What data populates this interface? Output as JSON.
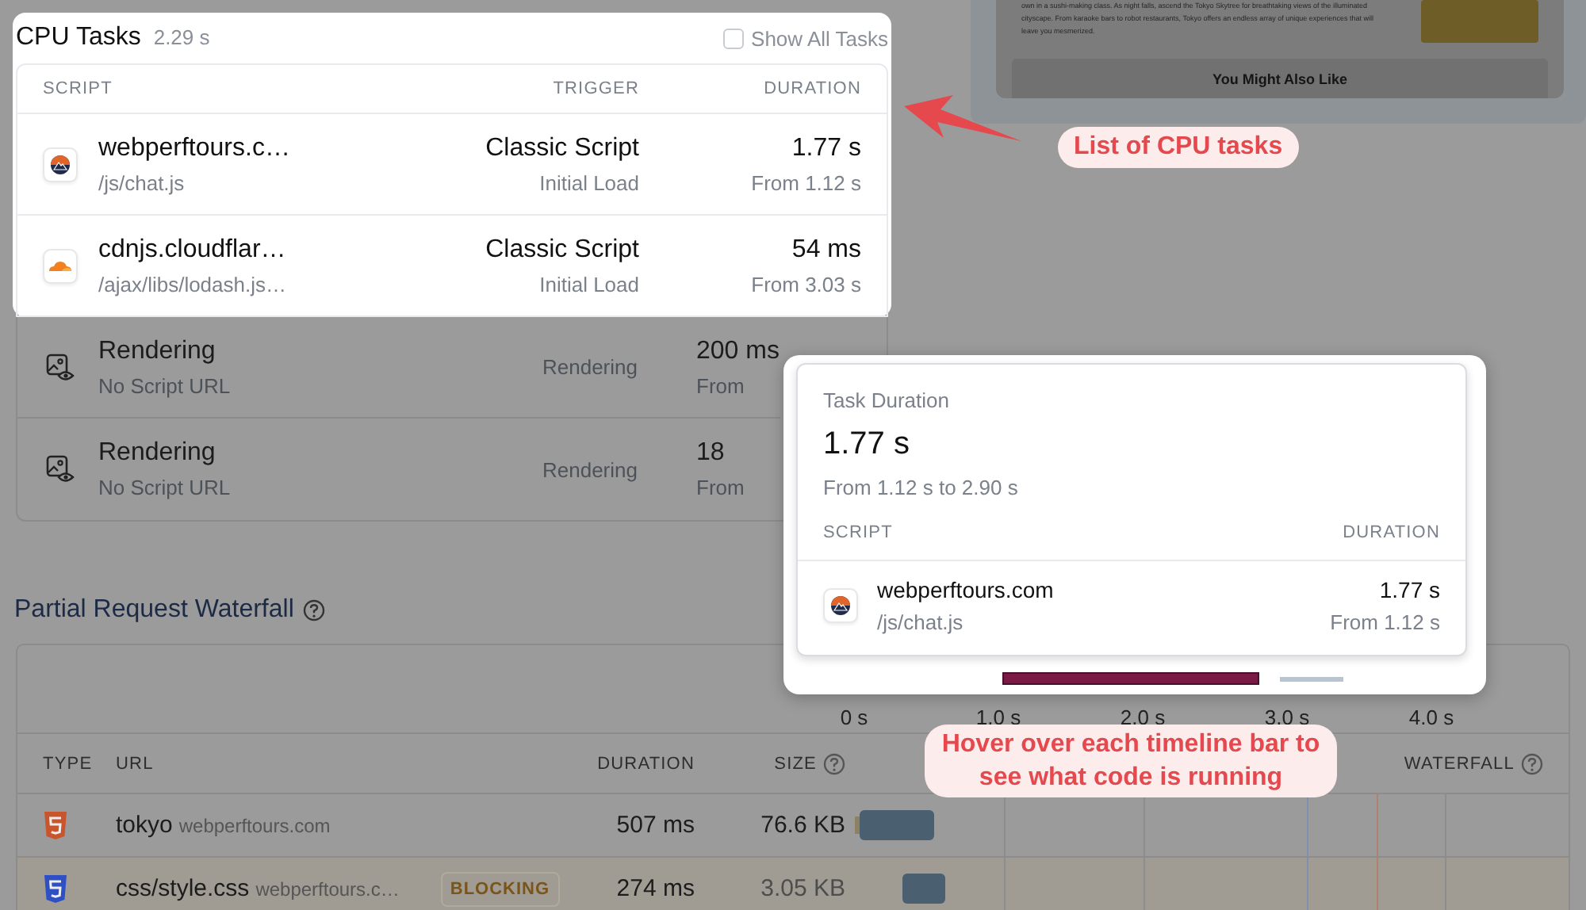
{
  "cpu_tasks": {
    "title": "CPU Tasks",
    "total": "2.29 s",
    "show_all": {
      "label": "Show All Tasks",
      "checked": false
    },
    "columns": [
      "SCRIPT",
      "TRIGGER",
      "DURATION"
    ],
    "rows": [
      {
        "kind": "site",
        "name": "webperftours.c…",
        "path": "/js/chat.js",
        "trigger": "Classic Script",
        "cause": "Initial Load",
        "duration": "1.77 s",
        "start": "From 1.12 s",
        "highlighted": true
      },
      {
        "kind": "cloud",
        "name": "cdnjs.cloudflar…",
        "path": "/ajax/libs/lodash.js…",
        "trigger": "Classic Script",
        "cause": "Initial Load",
        "duration": "54 ms",
        "start": "From 3.03 s",
        "highlighted": true
      },
      {
        "kind": "render",
        "name": "Rendering",
        "path": "No Script URL",
        "cause": "Rendering",
        "duration": "200 ms",
        "start": "From",
        "highlighted": false
      },
      {
        "kind": "render",
        "name": "Rendering",
        "path": "No Script URL",
        "cause": "Rendering",
        "duration": "18",
        "start": "From",
        "highlighted": false
      }
    ]
  },
  "preview": {
    "paragraph": "own in a sushi-making class. As night falls, ascend the Tokyo Skytree for breathtaking views of the illuminated cityscape. From karaoke bars to robot restaurants, Tokyo offers an endless array of unique experiences that will leave you mesmerized.",
    "heading": "You Might Also Like"
  },
  "tooltip": {
    "label": "Task Duration",
    "value": "1.77 s",
    "range": "From 1.12 s to 2.90 s",
    "columns": [
      "SCRIPT",
      "DURATION"
    ],
    "row": {
      "kind": "site",
      "name": "webperftours.com",
      "path": "/js/chat.js",
      "duration": "1.77 s",
      "start": "From 1.12 s"
    }
  },
  "waterfall": {
    "title": "Partial Request Waterfall",
    "axis": [
      "0 s",
      "1.0 s",
      "2.0 s",
      "3.0 s",
      "4.0 s"
    ],
    "columns": [
      {
        "label": "TYPE",
        "help": false
      },
      {
        "label": "URL",
        "help": false
      },
      {
        "label": "DURATION",
        "help": false
      },
      {
        "label": "SIZE",
        "help": true
      },
      {
        "label": "WATERFALL",
        "help": true
      }
    ],
    "rows": [
      {
        "kind": "html",
        "name": "tokyo",
        "host": "webperftours.com",
        "duration": "507 ms",
        "size": "76.6 KB"
      },
      {
        "kind": "css",
        "name": "css/style.css",
        "host": "webperftours.c…",
        "badge": "BLOCKING",
        "duration": "274 ms",
        "size": "3.05 KB"
      }
    ]
  },
  "annotations": [
    {
      "text": "List of CPU tasks"
    },
    {
      "text": "Hover over each timeline bar to see what code is running"
    }
  ]
}
